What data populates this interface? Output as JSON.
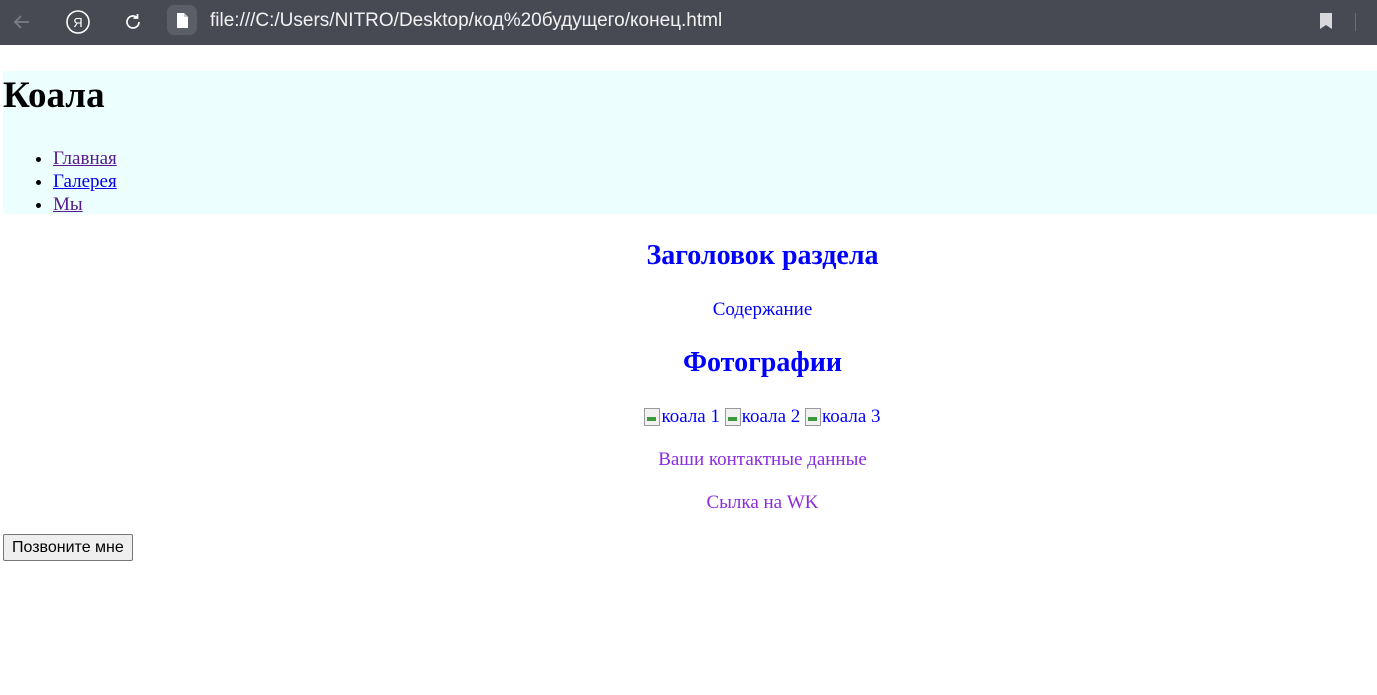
{
  "browser": {
    "address": "file:///C:/Users/NITRO/Desktop/код%20будущего/конец.html",
    "colors": {
      "toolbar": "#484a53",
      "text": "#f2f2f2"
    }
  },
  "page": {
    "title": "Коала",
    "nav": [
      {
        "label": "Главная"
      },
      {
        "label": "Галерея"
      },
      {
        "label": "Мы"
      }
    ],
    "section_heading": "Заголовок раздела",
    "content": "Содержание",
    "photos_heading": "Фотографии",
    "photos": [
      {
        "alt": "коала 1"
      },
      {
        "alt": "коала 2"
      },
      {
        "alt": "коала 3"
      }
    ],
    "contact": "Ваши контактные данные",
    "vk_link": "Сылка на WK",
    "call_button": "Позвоните мне",
    "colors": {
      "header_bg": "#edfefe",
      "heading": "#0000ff",
      "contact": "#8a2be2"
    }
  }
}
